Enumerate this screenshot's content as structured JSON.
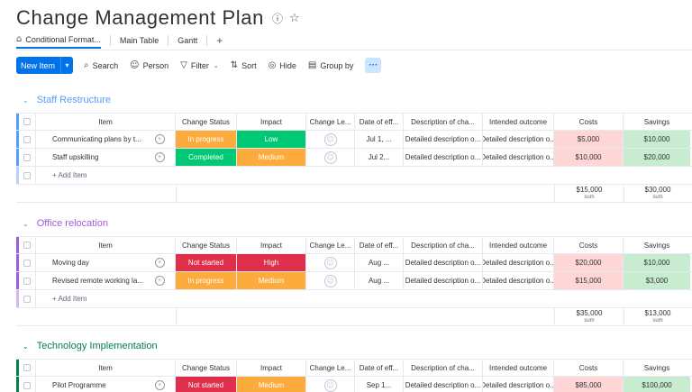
{
  "board": {
    "title": "Change Management Plan",
    "info_icon": "info-icon",
    "star_icon": "star-icon"
  },
  "tabs": [
    {
      "label": "Conditional Format...",
      "active": true
    },
    {
      "label": "Main Table",
      "active": false
    },
    {
      "label": "Gantt",
      "active": false
    }
  ],
  "toolbar": {
    "new_item": "New Item",
    "search": "Search",
    "person": "Person",
    "filter": "Filter",
    "sort": "Sort",
    "hide": "Hide",
    "group_by": "Group by",
    "more": "···"
  },
  "columns": {
    "item": "Item",
    "status": "Change Status",
    "impact": "Impact",
    "lead": "Change Le...",
    "date": "Date of eff...",
    "desc": "Description of cha...",
    "outcome": "Intended outcome",
    "costs": "Costs",
    "savings": "Savings"
  },
  "colors": {
    "in_progress": "#fdab3d",
    "completed": "#00c875",
    "not_started": "#df2f4a",
    "low": "#00c875",
    "medium": "#fdab3d",
    "high": "#df2f4a",
    "cost_bg": "#ffd6d6",
    "saving_bg": "#c8ecd0"
  },
  "add_item_label": "+ Add Item",
  "sum_label": "sum",
  "groups": [
    {
      "title": "Staff Restructure",
      "color": "#579bfc",
      "rows": [
        {
          "item": "Communicating plans by t...",
          "status": "In progress",
          "status_color": "#fdab3d",
          "impact": "Low",
          "impact_color": "#00c875",
          "date": "Jul 1, ...",
          "desc": "Detailed description o...",
          "outcome": "Detailed description o...",
          "cost": "$5,000",
          "saving": "$10,000"
        },
        {
          "item": "Staff upskilling",
          "status": "Completed",
          "status_color": "#00c875",
          "impact": "Medium",
          "impact_color": "#fdab3d",
          "date": "Jul 2...",
          "desc": "Detailed description o...",
          "outcome": "Detailed description o...",
          "cost": "$10,000",
          "saving": "$20,000"
        }
      ],
      "sum_cost": "$15,000",
      "sum_saving": "$30,000"
    },
    {
      "title": "Office relocation",
      "color": "#a25ddc",
      "rows": [
        {
          "item": "Moving day",
          "status": "Not started",
          "status_color": "#df2f4a",
          "impact": "High",
          "impact_color": "#df2f4a",
          "date": "Aug ...",
          "desc": "Detailed description o...",
          "outcome": "Detailed description o...",
          "cost": "$20,000",
          "saving": "$10,000"
        },
        {
          "item": "Revised remote working la...",
          "status": "In progress",
          "status_color": "#fdab3d",
          "impact": "Medium",
          "impact_color": "#fdab3d",
          "date": "Aug ...",
          "desc": "Detailed description o...",
          "outcome": "Detailed description o...",
          "cost": "$15,000",
          "saving": "$3,000"
        }
      ],
      "sum_cost": "$35,000",
      "sum_saving": "$13,000"
    },
    {
      "title": "Technology Implementation",
      "color": "#037f4c",
      "rows": [
        {
          "item": "Pilot Programme",
          "status": "Not started",
          "status_color": "#df2f4a",
          "impact": "Medium",
          "impact_color": "#fdab3d",
          "date": "Sep 1...",
          "desc": "Detailed description o...",
          "outcome": "Detailed description o...",
          "cost": "$85,000",
          "saving": "$100,000"
        }
      ]
    }
  ]
}
